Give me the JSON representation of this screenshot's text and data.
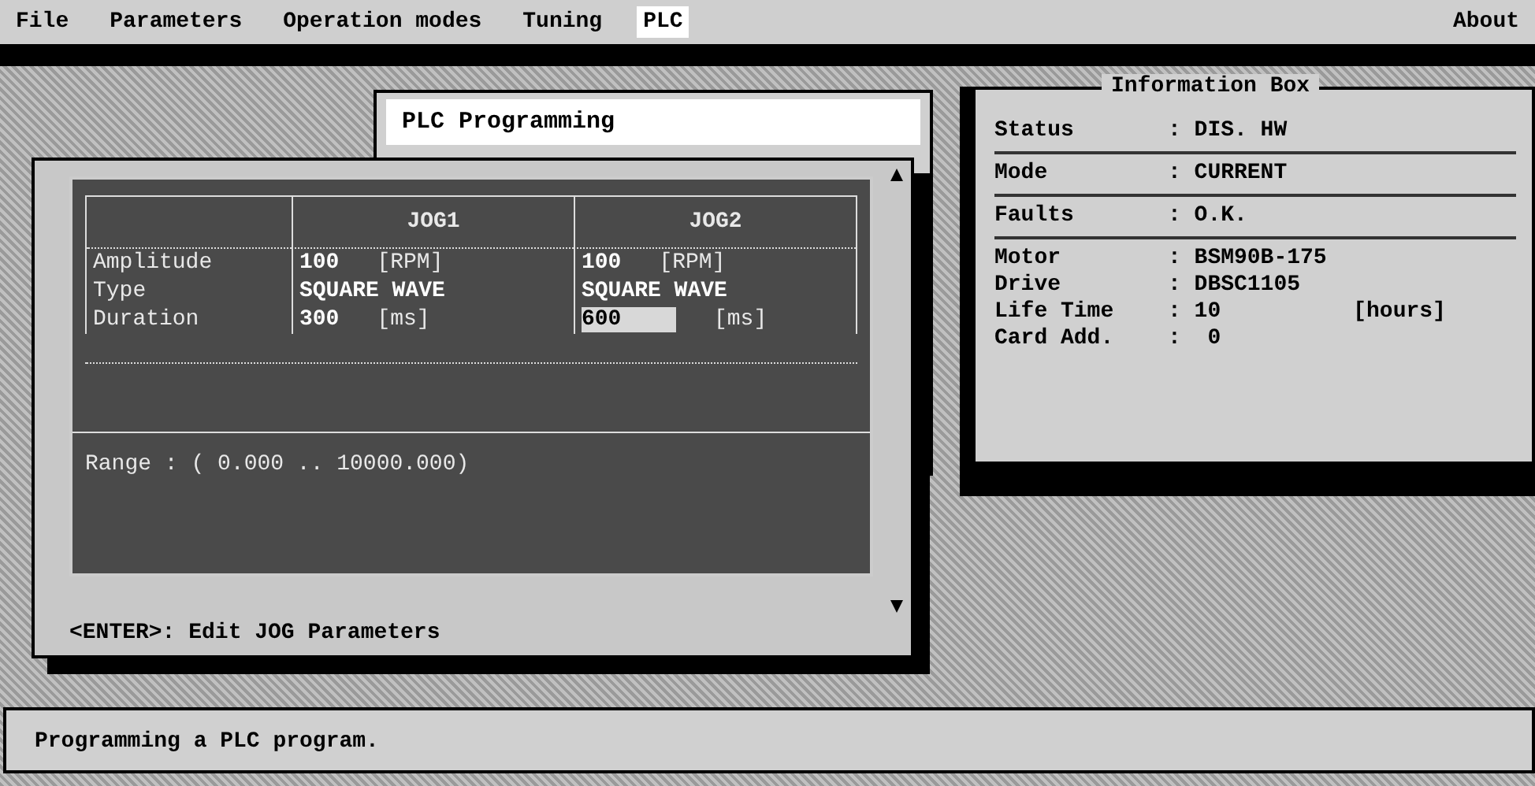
{
  "menu": [
    {
      "label": "File",
      "selected": false
    },
    {
      "label": "Parameters",
      "selected": false
    },
    {
      "label": "Operation modes",
      "selected": false
    },
    {
      "label": "Tuning",
      "selected": false
    },
    {
      "label": "PLC",
      "selected": true
    }
  ],
  "about": "About",
  "plc_window": {
    "title": "PLC Programming"
  },
  "jog_table": {
    "columns": [
      "JOG1",
      "JOG2"
    ],
    "rows": [
      {
        "label": "Amplitude",
        "cells": [
          {
            "value": "100",
            "unit": "[RPM]",
            "editing": false
          },
          {
            "value": "100",
            "unit": "[RPM]",
            "editing": false
          }
        ]
      },
      {
        "label": "Type",
        "cells": [
          {
            "value": "SQUARE WAVE",
            "editing": false
          },
          {
            "value": "SQUARE WAVE",
            "editing": false
          }
        ]
      },
      {
        "label": "Duration",
        "cells": [
          {
            "value": "300",
            "unit": "[ms]",
            "editing": false
          },
          {
            "value": "600",
            "unit": "[ms]",
            "editing": true
          }
        ]
      }
    ],
    "range": "Range : ( 0.000 .. 10000.000)",
    "footer": "<ENTER>: Edit JOG Parameters"
  },
  "info_box": {
    "title": "Information Box",
    "sections": [
      [
        {
          "label": "Status",
          "value": ": DIS. HW"
        }
      ],
      [
        {
          "label": "Mode",
          "value": ": CURRENT"
        }
      ],
      [
        {
          "label": "Faults",
          "value": ": O.K."
        }
      ],
      [
        {
          "label": "Motor",
          "value": ": BSM90B-175"
        },
        {
          "label": "Drive",
          "value": ": DBSC1105"
        },
        {
          "label": "Life Time",
          "value": ": 10          [hours]"
        },
        {
          "label": "Card Add.",
          "value": ":  0"
        }
      ]
    ]
  },
  "status_bar": "Programming a PLC program."
}
